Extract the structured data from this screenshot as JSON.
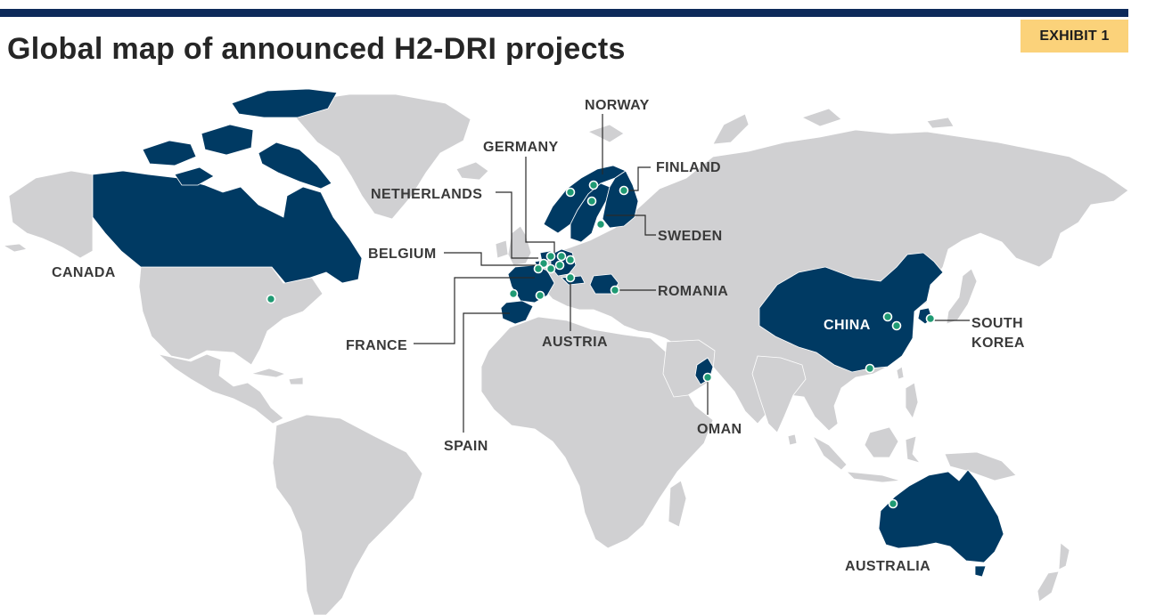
{
  "header": {
    "title": "Global map of announced H2-DRI projects",
    "exhibit": "EXHIBIT 1"
  },
  "colors": {
    "top_rule": "#0d2a5a",
    "exhibit_badge": "#fbd27a",
    "land": "#d0d0d2",
    "highlighted_country": "#003a63",
    "project_marker": "#1f9a73",
    "leader_line": "#2a2a2a",
    "label_text": "#3a3a3a"
  },
  "map": {
    "highlighted_countries": [
      "Canada",
      "Norway",
      "Sweden",
      "Finland",
      "Germany",
      "Netherlands",
      "Belgium",
      "France",
      "Spain",
      "Austria",
      "Romania",
      "Oman",
      "China",
      "South Korea",
      "Australia"
    ],
    "labels": {
      "norway": "NORWAY",
      "germany": "GERMANY",
      "finland": "FINLAND",
      "netherlands": "NETHERLANDS",
      "sweden": "SWEDEN",
      "belgium": "BELGIUM",
      "canada": "CANADA",
      "romania": "ROMANIA",
      "china": "CHINA",
      "south_korea_line1": "SOUTH",
      "south_korea_line2": "KOREA",
      "france": "FRANCE",
      "austria": "AUSTRIA",
      "spain": "SPAIN",
      "oman": "OMAN",
      "australia": "AUSTRALIA"
    }
  }
}
